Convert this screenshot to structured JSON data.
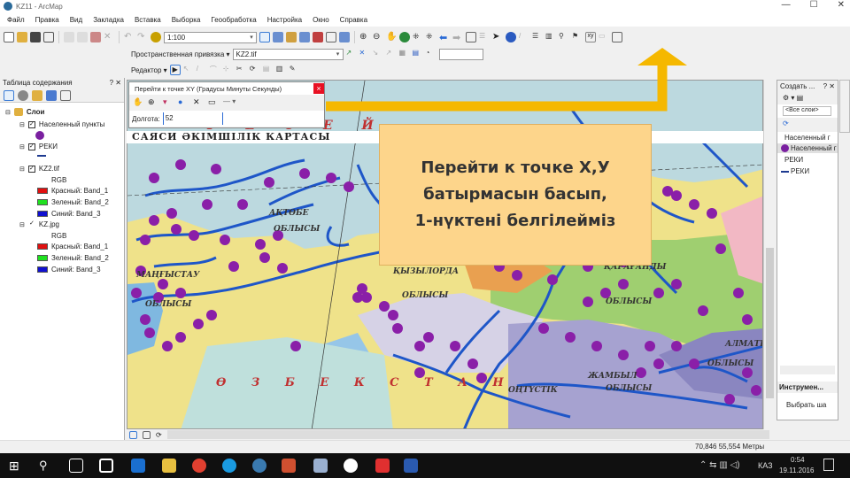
{
  "window": {
    "title": "KZ11 - ArcMap",
    "min": "—",
    "max": "☐",
    "close": "✕"
  },
  "menu": [
    "Файл",
    "Правка",
    "Вид",
    "Закладка",
    "Вставка",
    "Выборка",
    "Геообработка",
    "Настройка",
    "Окно",
    "Справка"
  ],
  "toolbar": {
    "scale": "1:100",
    "snapping_label": "Пространственная привязка ▾",
    "snapping_layer": "KZ2.tif",
    "editor_label": "Редактор ▾"
  },
  "toc": {
    "title": "Таблица содержания",
    "pin": "? ✕",
    "root": "Слои",
    "layers": [
      {
        "name": "Населенный пункты"
      },
      {
        "name": "РЕКИ"
      },
      {
        "name": "KZ2.tif",
        "rgb": "RGB",
        "bands": [
          "Красный: Band_1",
          "Зеленый: Band_2",
          "Синий: Band_3"
        ]
      },
      {
        "name": "KZ.jpg",
        "rgb": "RGB",
        "bands": [
          "Красный: Band_1",
          "Зеленый: Band_2",
          "Синий: Band_3"
        ]
      }
    ]
  },
  "dialog": {
    "title": "Перейти к точке XY (Градусы Минуты Секунды)",
    "close": "×",
    "field_label": "Долгота:",
    "field_value": "52"
  },
  "map": {
    "title": "САЯСИ ӘКІМШІЛІК КАРТАСЫ",
    "labels": [
      "Р Е С Е Й",
      "АҚТӨБЕ",
      "ОБЛЫСЫ",
      "МАҢҒЫСТАУ",
      "ОБЛЫСЫ",
      "ҚЫЗЫЛОРДА",
      "ОБЛЫСЫ",
      "ҚАРАҒАНДЫ",
      "ОБЛЫСЫ",
      "ЖАМБЫЛ",
      "ОБЛЫСЫ",
      "ОҢТҮСТІК",
      "АЛМАТЫ",
      "ОБЛЫСЫ",
      "Ө З Б Е К С Т А Н"
    ]
  },
  "callout": {
    "lines": [
      "Перейти к точке X,У",
      "батырмасын басып,",
      "1-нүктені белгілейміз"
    ]
  },
  "status": {
    "coords": "70,846 55,554 Метры"
  },
  "right_panel": {
    "title": "Создать ...",
    "pin": "? ✕",
    "filter": "<Все слои>",
    "items": [
      "Населенный г",
      "Населенный г",
      "РЕКИ",
      "РЕКИ"
    ],
    "tools_title": "Инструмен...",
    "tools_item": "Выбрать ша"
  },
  "taskbar": {
    "lang": "КАЗ",
    "time": "0:54",
    "date": "19.11.2016"
  },
  "colors": {
    "accent_arrow": "#f5b800",
    "point": "#8a1fa8",
    "river": "#1e56c8"
  }
}
